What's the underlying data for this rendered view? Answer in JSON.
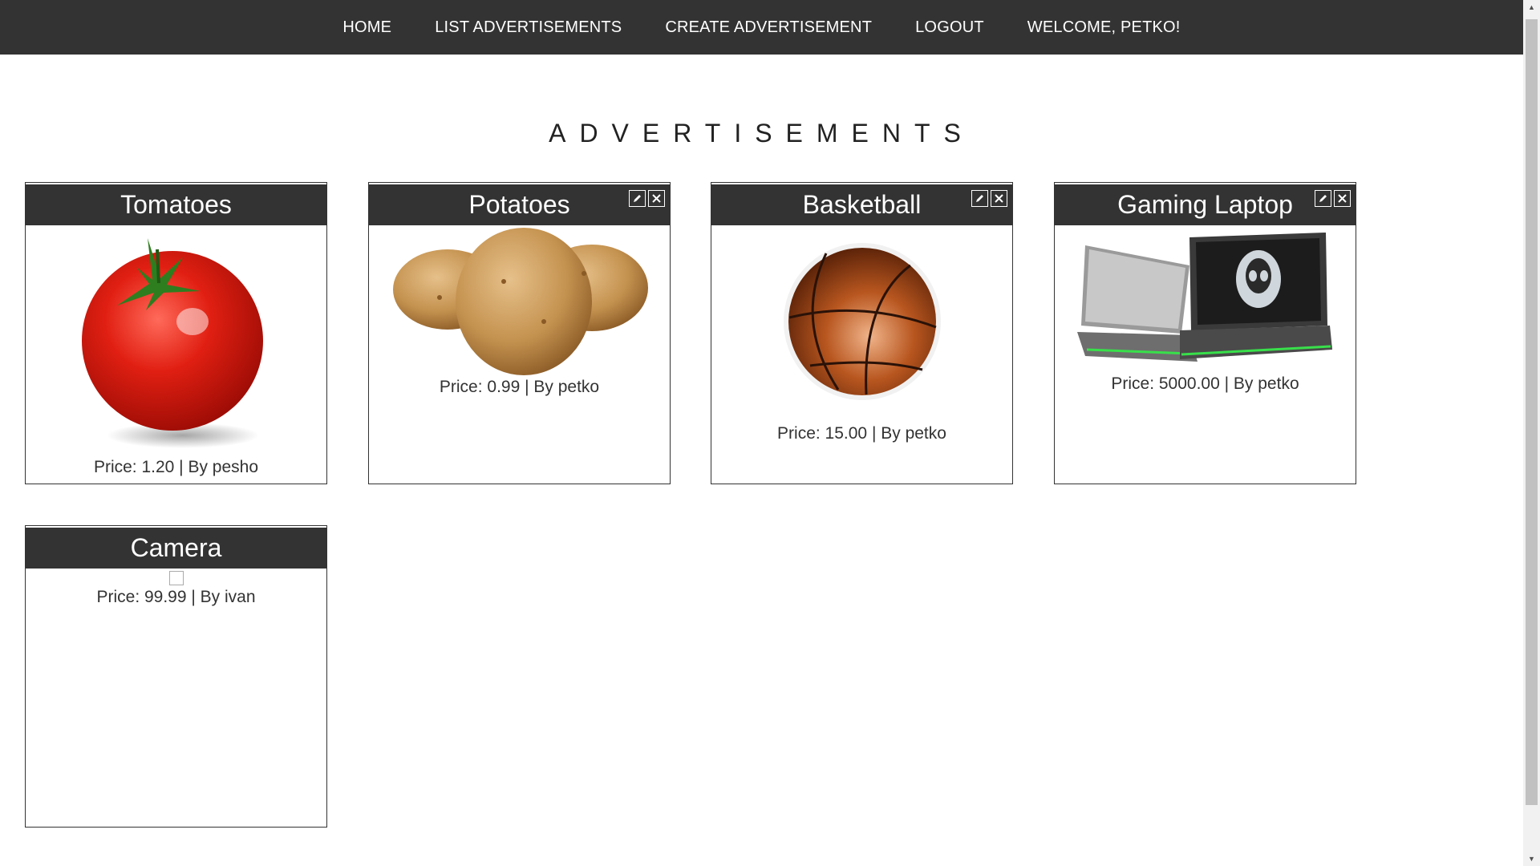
{
  "nav": {
    "home": "HOME",
    "list": "LIST ADVERTISEMENTS",
    "create": "CREATE ADVERTISEMENT",
    "logout": "LOGOUT",
    "welcome": "WELCOME, PETKO!"
  },
  "page": {
    "title": "ADVERTISEMENTS"
  },
  "ads": [
    {
      "title": "Tomatoes",
      "price_label": "Price: 1.20 | By pesho",
      "image": "tomato-image",
      "owned": false
    },
    {
      "title": "Potatoes",
      "price_label": "Price: 0.99 | By petko",
      "image": "potatoes-image",
      "owned": true
    },
    {
      "title": "Basketball",
      "price_label": "Price: 15.00 | By petko",
      "image": "basketball-image",
      "owned": true
    },
    {
      "title": "Gaming Laptop",
      "price_label": "Price: 5000.00 | By petko",
      "image": "laptop-image",
      "owned": true
    },
    {
      "title": "Camera",
      "price_label": "Price: 99.99 | By ivan",
      "image": "broken-image",
      "owned": false
    }
  ],
  "colors": {
    "nav_bg": "#333333",
    "card_header_bg": "#333333",
    "text": "#333333"
  },
  "icons": {
    "edit": "pencil-icon",
    "delete": "close-icon"
  }
}
